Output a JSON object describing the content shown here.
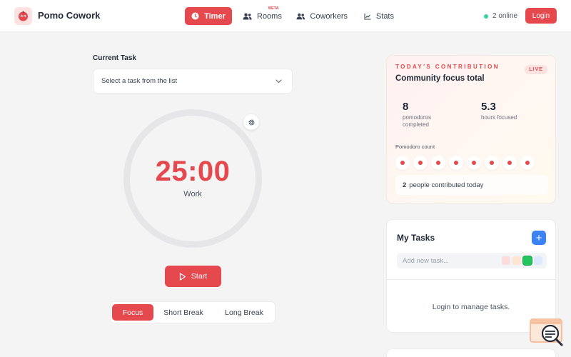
{
  "header": {
    "brand": "Pomo Cowork",
    "nav": [
      {
        "label": "Timer",
        "icon": "clock-icon",
        "active": true
      },
      {
        "label": "Rooms",
        "icon": "users-icon",
        "badge": "BETA"
      },
      {
        "label": "Coworkers",
        "icon": "users-icon"
      },
      {
        "label": "Stats",
        "icon": "chart-icon"
      }
    ],
    "online": "2 online",
    "login": "Login"
  },
  "timer": {
    "current_task_label": "Current Task",
    "task_placeholder": "Select a task from the list",
    "time": "25:00",
    "mode": "Work",
    "start": "Start",
    "modes": [
      "Focus",
      "Short Break",
      "Long Break"
    ],
    "active_mode": "Focus"
  },
  "contribution": {
    "eyebrow": "TODAY'S CONTRIBUTION",
    "title": "Community focus total",
    "live": "LIVE",
    "pomodoros": "8",
    "pomodoros_label": "pomodoros completed",
    "hours": "5.3",
    "hours_label": "hours focused",
    "pomodoro_count_label": "Pomodoro count",
    "pomodoro_count": 8,
    "people_count": "2",
    "people_text": "people contributed today"
  },
  "tasks": {
    "title": "My Tasks",
    "add": "+",
    "new_placeholder": "Add new task...",
    "swatches": [
      "#fcdcdc",
      "#fde5d2",
      "#22c55e",
      "#dbeafe"
    ],
    "selected_swatch": 2,
    "empty": "Login to manage tasks."
  },
  "colors": {
    "accent": "#e5484d",
    "blue": "#3b82f6",
    "online": "#34d399"
  }
}
